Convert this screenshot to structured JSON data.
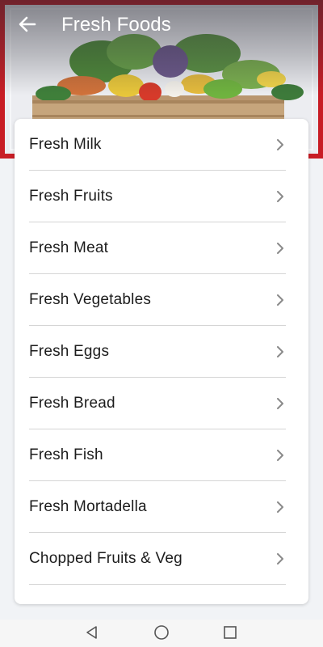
{
  "header": {
    "title": "Fresh Foods",
    "back_icon": "arrow-left-icon",
    "accent_color": "#c81d25"
  },
  "list": {
    "items": [
      {
        "label": "Fresh Milk"
      },
      {
        "label": "Fresh Fruits"
      },
      {
        "label": "Fresh Meat"
      },
      {
        "label": "Fresh Vegetables"
      },
      {
        "label": "Fresh Eggs"
      },
      {
        "label": "Fresh Bread"
      },
      {
        "label": "Fresh Fish"
      },
      {
        "label": "Fresh Mortadella"
      },
      {
        "label": "Chopped Fruits & Veg"
      }
    ],
    "chevron_icon": "chevron-right-icon"
  },
  "navbar": {
    "back_icon": "triangle-back-icon",
    "home_icon": "circle-home-icon",
    "recents_icon": "square-recents-icon"
  }
}
